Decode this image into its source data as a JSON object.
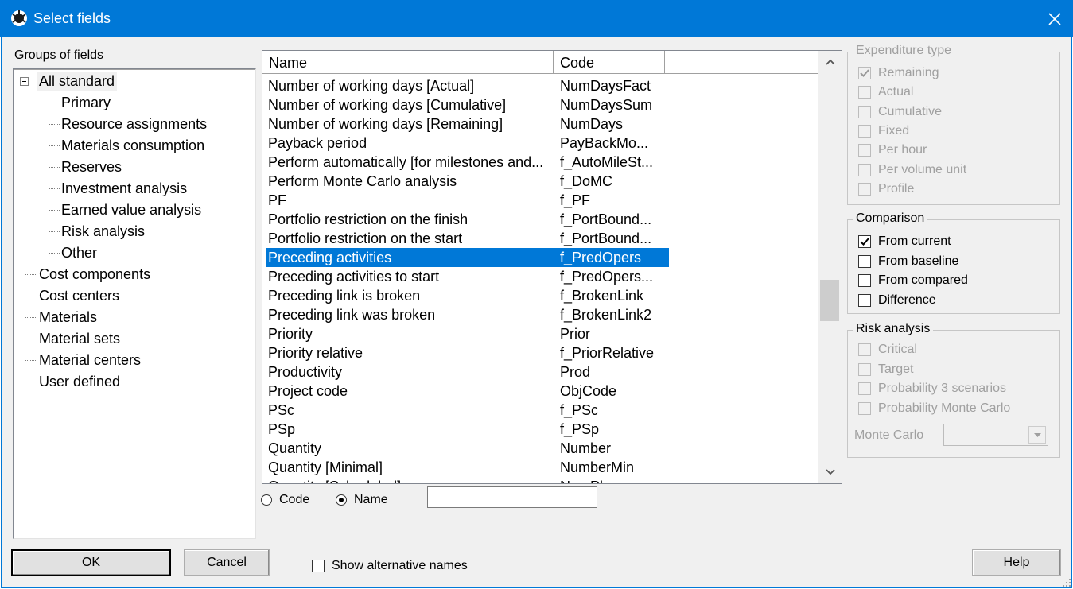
{
  "window": {
    "title": "Select fields"
  },
  "groups_label": "Groups of fields",
  "tree": [
    {
      "label": "All standard",
      "level": 0
    },
    {
      "label": "Primary",
      "level": 1
    },
    {
      "label": "Resource assignments",
      "level": 1
    },
    {
      "label": "Materials consumption",
      "level": 1
    },
    {
      "label": "Reserves",
      "level": 1
    },
    {
      "label": "Investment analysis",
      "level": 1
    },
    {
      "label": "Earned value analysis",
      "level": 1
    },
    {
      "label": "Risk analysis",
      "level": 1
    },
    {
      "label": "Other",
      "level": 1
    },
    {
      "label": "Cost components",
      "level": 0
    },
    {
      "label": "Cost centers",
      "level": 0
    },
    {
      "label": "Materials",
      "level": 0
    },
    {
      "label": "Material sets",
      "level": 0
    },
    {
      "label": "Material centers",
      "level": 0
    },
    {
      "label": "User defined",
      "level": 0
    }
  ],
  "list": {
    "columns": [
      "Name",
      "Code"
    ],
    "rows": [
      {
        "name": "Number of working days [Actual]",
        "code": "NumDaysFact"
      },
      {
        "name": "Number of working days [Cumulative]",
        "code": "NumDaysSum"
      },
      {
        "name": "Number of working days [Remaining]",
        "code": "NumDays"
      },
      {
        "name": "Payback period",
        "code": "PayBackMo..."
      },
      {
        "name": "Perform automatically [for milestones and...",
        "code": "f_AutoMileSt..."
      },
      {
        "name": "Perform Monte Carlo analysis",
        "code": "f_DoMC"
      },
      {
        "name": "PF",
        "code": "f_PF"
      },
      {
        "name": "Portfolio restriction on the finish",
        "code": "f_PortBound..."
      },
      {
        "name": "Portfolio restriction on the start",
        "code": "f_PortBound..."
      },
      {
        "name": "Preceding activities",
        "code": "f_PredOpers",
        "selected": true
      },
      {
        "name": "Preceding activities to start",
        "code": "f_PredOpers..."
      },
      {
        "name": "Preceding link is broken",
        "code": "f_BrokenLink"
      },
      {
        "name": "Preceding link was broken",
        "code": "f_BrokenLink2"
      },
      {
        "name": "Priority",
        "code": "Prior"
      },
      {
        "name": "Priority relative",
        "code": "f_PriorRelative"
      },
      {
        "name": "Productivity",
        "code": "Prod"
      },
      {
        "name": "Project code",
        "code": "ObjCode"
      },
      {
        "name": "PSc",
        "code": "f_PSc"
      },
      {
        "name": "PSp",
        "code": "f_PSp"
      },
      {
        "name": "Quantity",
        "code": "Number"
      },
      {
        "name": "Quantity [Minimal]",
        "code": "NumberMin"
      },
      {
        "name": "Quantity [Scheduled]",
        "code": "NumPlan"
      }
    ]
  },
  "search": {
    "code_label": "Code",
    "name_label": "Name",
    "selected": "Name",
    "value": ""
  },
  "expenditure": {
    "legend": "Expenditure type",
    "items": [
      {
        "label": "Remaining",
        "checked": true
      },
      {
        "label": "Actual",
        "checked": false
      },
      {
        "label": "Cumulative",
        "checked": false
      },
      {
        "label": "Fixed",
        "checked": false
      },
      {
        "label": "Per hour",
        "checked": false
      },
      {
        "label": "Per volume unit",
        "checked": false
      },
      {
        "label": "Profile",
        "checked": false
      }
    ]
  },
  "comparison": {
    "legend": "Comparison",
    "items": [
      {
        "label": "From current",
        "checked": true
      },
      {
        "label": "From baseline",
        "checked": false
      },
      {
        "label": "From compared",
        "checked": false
      },
      {
        "label": "Difference",
        "checked": false
      }
    ]
  },
  "risk": {
    "legend": "Risk analysis",
    "items": [
      {
        "label": "Critical",
        "checked": false
      },
      {
        "label": "Target",
        "checked": false
      },
      {
        "label": "Probability 3 scenarios",
        "checked": false
      },
      {
        "label": "Probability Monte Carlo",
        "checked": false
      }
    ],
    "monte_carlo_label": "Monte Carlo",
    "monte_carlo_value": ""
  },
  "buttons": {
    "ok": "OK",
    "cancel": "Cancel",
    "help": "Help"
  },
  "show_alt_names": {
    "label": "Show alternative names",
    "checked": false
  },
  "colors": {
    "titlebar": "#0078d7",
    "selection": "#0078d7"
  }
}
